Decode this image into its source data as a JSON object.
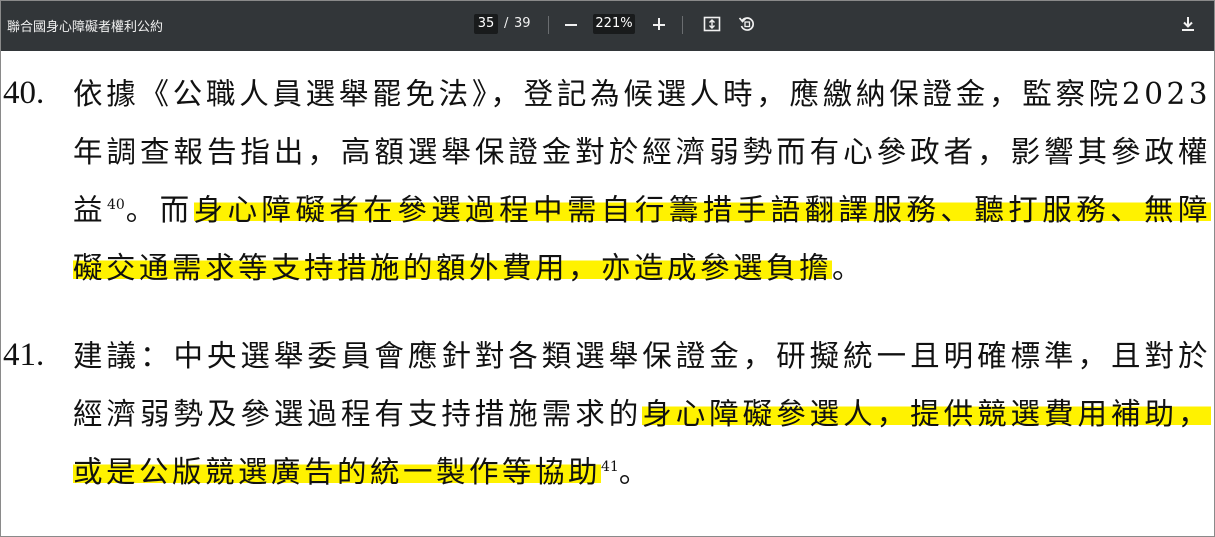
{
  "toolbar": {
    "title": "聯合國身心障礙者權利公約",
    "current_page": "35",
    "page_separator": "/",
    "total_pages": "39",
    "zoom": "221%"
  },
  "icons": {
    "zoom_out": "minus-icon",
    "zoom_in": "plus-icon",
    "fit": "fit-to-page-icon",
    "rotate": "rotate-icon",
    "download": "download-icon"
  },
  "colors": {
    "toolbar_bg": "#323639",
    "highlight": "#fff200"
  },
  "document": {
    "items": [
      {
        "number": "40.",
        "text_a": "依據《公職人員選舉罷免法》，登記為候選人時，應繳納保證金，監察院2023 年調查報告指出，高額選舉保證金對於經濟弱勢而有心參政者，影響其參政權益",
        "footnote": "40",
        "text_b": "。而",
        "highlight": "身心障礙者在參選過程中需自行籌措手語翻譯服務、聽打服務、無障礙交通需求等支持措施的額外費用，亦造成參選負擔",
        "text_c": "。"
      },
      {
        "number": "41.",
        "text_a": "建議：中央選舉委員會應針對各類選舉保證金，研擬統一且明確標準，且對於經濟弱勢及參選過程有支持措施需求的",
        "highlight": "身心障礙參選人，提供競選費用補助，或是公版競選廣告的統一製作等協助",
        "footnote": "41",
        "text_c": "。"
      }
    ]
  }
}
